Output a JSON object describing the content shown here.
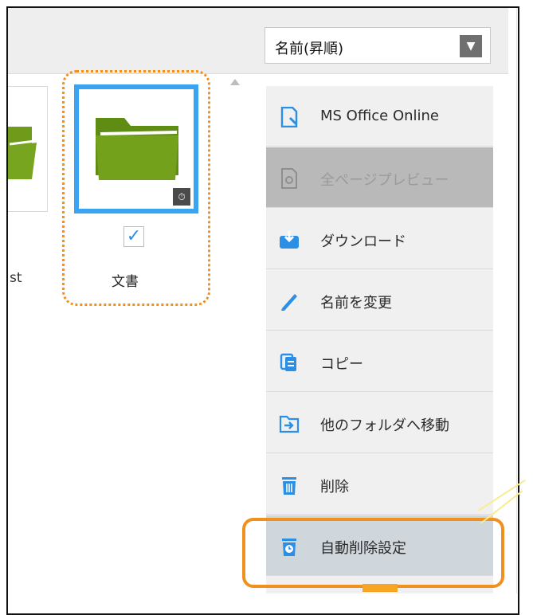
{
  "toolbar": {
    "sort_label": "名前(昇順)",
    "sort_arrow": "▼"
  },
  "files": [
    {
      "name": "st"
    },
    {
      "name": "文書",
      "checked": "✓",
      "badge": "⏱"
    }
  ],
  "menu": {
    "items": [
      {
        "label": "MS Office Online",
        "icon": "office-doc-icon"
      },
      {
        "label": "全ページプレビュー",
        "icon": "preview-icon",
        "state": "disabled"
      },
      {
        "label": "ダウンロード",
        "icon": "download-icon"
      },
      {
        "label": "名前を変更",
        "icon": "pencil-icon"
      },
      {
        "label": "コピー",
        "icon": "copy-icon"
      },
      {
        "label": "他のフォルダへ移動",
        "icon": "move-folder-icon"
      },
      {
        "label": "削除",
        "icon": "trash-icon"
      },
      {
        "label": "自動削除設定",
        "icon": "auto-delete-icon",
        "state": "highlighted"
      }
    ]
  },
  "colors": {
    "accent_blue": "#39a4f1",
    "folder_green": "#6f9a1a",
    "callout_orange": "#f0901f"
  }
}
